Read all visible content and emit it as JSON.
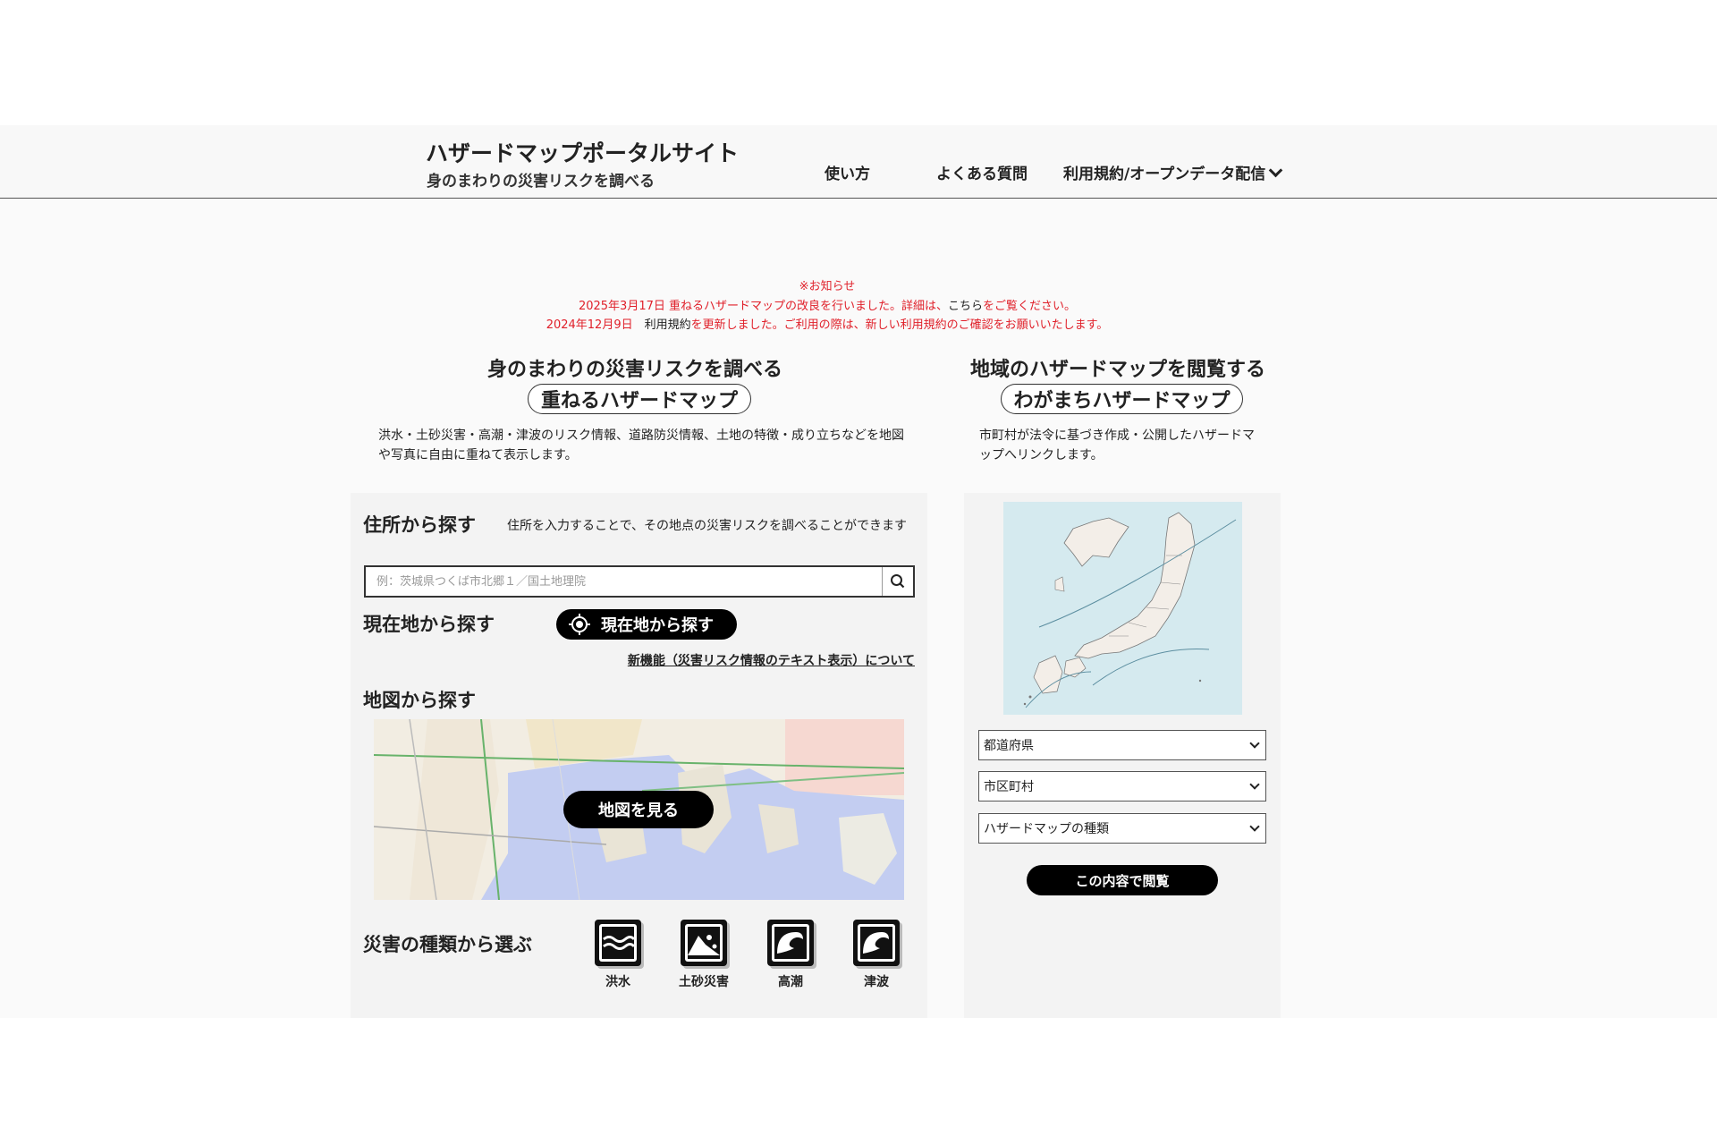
{
  "header": {
    "title": "ハザードマップポータルサイト",
    "subtitle": "身のまわりの災害リスクを調べる",
    "nav": {
      "usage": "使い方",
      "faq": "よくある質問",
      "terms": "利用規約/オープンデータ配信"
    }
  },
  "notices": {
    "heading": "※お知らせ",
    "line1_pre": "2025年3月17日  重ねるハザードマップの改良を行いました。詳細は、",
    "line1_link": "こちら",
    "line1_post": "をご覧ください。",
    "line2_pre": "2024年12月9日　",
    "line2_link": "利用規約",
    "line2_post": "を更新しました。ご利用の際は、新しい利用規約のご確認をお願いいたします。"
  },
  "left": {
    "heading": "身のまわりの災害リスクを調べる",
    "title": "重ねるハザードマップ",
    "description": "洪水・土砂災害・高潮・津波のリスク情報、道路防災情報、土地の特徴・成り立ちなどを地図や写真に自由に重ねて表示します。",
    "address": {
      "label": "住所から探す",
      "hint": "住所を入力することで、その地点の災害リスクを調べることができます",
      "placeholder": "例：茨城県つくば市北郷１／国土地理院"
    },
    "current": {
      "label": "現在地から探す",
      "button": "現在地から探す",
      "new_feature_link": "新機能（災害リスク情報のテキスト表示）について"
    },
    "map": {
      "label": "地図から探す",
      "button": "地図を見る"
    },
    "disaster": {
      "label": "災害の種類から選ぶ",
      "types": [
        "洪水",
        "土砂災害",
        "高潮",
        "津波"
      ]
    }
  },
  "right": {
    "heading": "地域のハザードマップを閲覧する",
    "title": "わがまちハザードマップ",
    "description": "市町村が法令に基づき作成・公開したハザードマップへリンクします。",
    "selects": {
      "prefecture": "都道府県",
      "municipality": "市区町村",
      "type": "ハザードマップの種類"
    },
    "view_button": "この内容で閲覧"
  },
  "colors": {
    "notice_red": "#e0202a",
    "panel_bg": "#f3f3f3",
    "button_black": "#000000",
    "japan_sea": "#d5eaef",
    "japan_land": "#f3eee8"
  }
}
